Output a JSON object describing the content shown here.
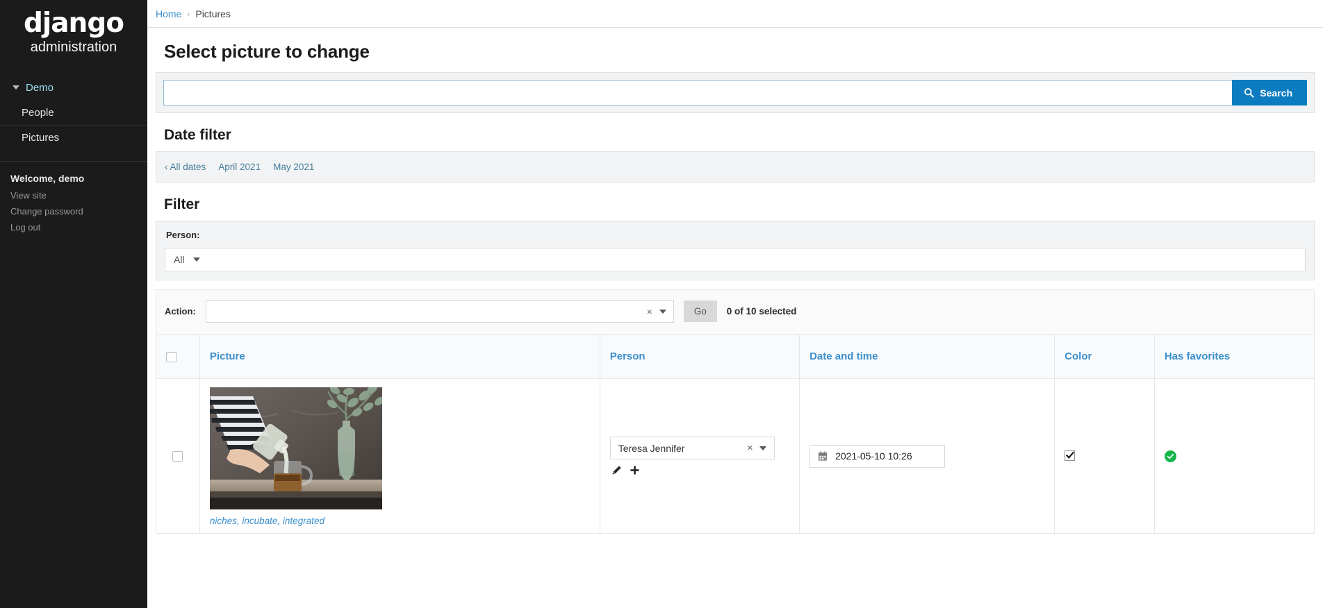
{
  "sidebar": {
    "logo": "django",
    "logo_sub": "administration",
    "app_label": "Demo",
    "nav_items": [
      {
        "label": "People"
      },
      {
        "label": "Pictures"
      }
    ],
    "welcome": "Welcome, demo",
    "user_links": [
      {
        "label": "View site"
      },
      {
        "label": "Change password"
      },
      {
        "label": "Log out"
      }
    ]
  },
  "breadcrumbs": {
    "home": "Home",
    "separator": "›",
    "current": "Pictures"
  },
  "page": {
    "title": "Select picture to change"
  },
  "search": {
    "value": "",
    "placeholder": "",
    "button_label": "Search",
    "icon": "search-icon",
    "button_color": "#0c7cc0"
  },
  "date_filter": {
    "title": "Date filter",
    "links": [
      {
        "label": "‹ All dates"
      },
      {
        "label": "April 2021"
      },
      {
        "label": "May 2021"
      }
    ]
  },
  "filter": {
    "title": "Filter",
    "person_label": "Person:",
    "person_value": "All"
  },
  "action_bar": {
    "label": "Action:",
    "selected": "",
    "clear_icon": "close-icon",
    "dropdown_icon": "chevron-down-icon",
    "go_label": "Go",
    "selection_count": "0 of 10 selected"
  },
  "table": {
    "columns": [
      {
        "label": "Picture"
      },
      {
        "label": "Person"
      },
      {
        "label": "Date and time"
      },
      {
        "label": "Color"
      },
      {
        "label": "Has favorites"
      }
    ],
    "rows": [
      {
        "caption": "niches, incubate, integrated",
        "person": "Teresa Jennifer",
        "datetime": "2021-05-10 10:26",
        "color_checked": true,
        "has_favorites": true
      }
    ]
  }
}
